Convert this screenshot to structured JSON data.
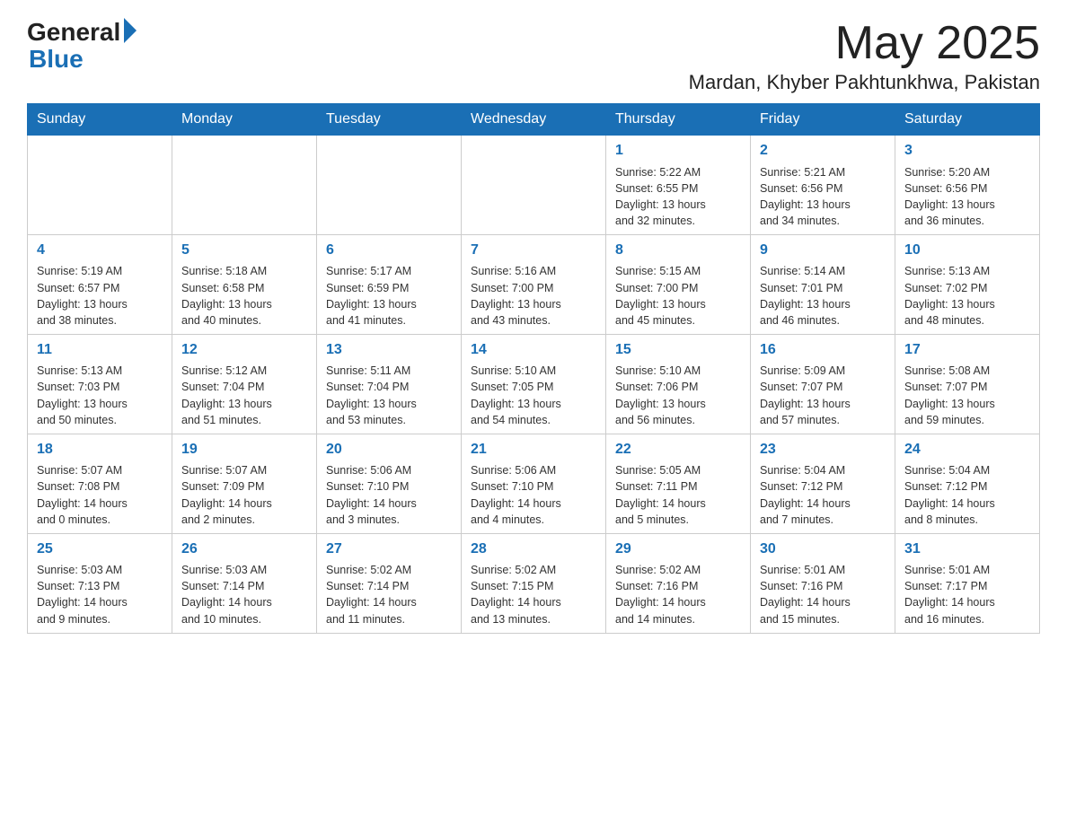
{
  "header": {
    "logo_general": "General",
    "logo_blue": "Blue",
    "month_title": "May 2025",
    "location": "Mardan, Khyber Pakhtunkhwa, Pakistan"
  },
  "weekdays": [
    "Sunday",
    "Monday",
    "Tuesday",
    "Wednesday",
    "Thursday",
    "Friday",
    "Saturday"
  ],
  "weeks": [
    [
      {
        "day": "",
        "info": ""
      },
      {
        "day": "",
        "info": ""
      },
      {
        "day": "",
        "info": ""
      },
      {
        "day": "",
        "info": ""
      },
      {
        "day": "1",
        "info": "Sunrise: 5:22 AM\nSunset: 6:55 PM\nDaylight: 13 hours\nand 32 minutes."
      },
      {
        "day": "2",
        "info": "Sunrise: 5:21 AM\nSunset: 6:56 PM\nDaylight: 13 hours\nand 34 minutes."
      },
      {
        "day": "3",
        "info": "Sunrise: 5:20 AM\nSunset: 6:56 PM\nDaylight: 13 hours\nand 36 minutes."
      }
    ],
    [
      {
        "day": "4",
        "info": "Sunrise: 5:19 AM\nSunset: 6:57 PM\nDaylight: 13 hours\nand 38 minutes."
      },
      {
        "day": "5",
        "info": "Sunrise: 5:18 AM\nSunset: 6:58 PM\nDaylight: 13 hours\nand 40 minutes."
      },
      {
        "day": "6",
        "info": "Sunrise: 5:17 AM\nSunset: 6:59 PM\nDaylight: 13 hours\nand 41 minutes."
      },
      {
        "day": "7",
        "info": "Sunrise: 5:16 AM\nSunset: 7:00 PM\nDaylight: 13 hours\nand 43 minutes."
      },
      {
        "day": "8",
        "info": "Sunrise: 5:15 AM\nSunset: 7:00 PM\nDaylight: 13 hours\nand 45 minutes."
      },
      {
        "day": "9",
        "info": "Sunrise: 5:14 AM\nSunset: 7:01 PM\nDaylight: 13 hours\nand 46 minutes."
      },
      {
        "day": "10",
        "info": "Sunrise: 5:13 AM\nSunset: 7:02 PM\nDaylight: 13 hours\nand 48 minutes."
      }
    ],
    [
      {
        "day": "11",
        "info": "Sunrise: 5:13 AM\nSunset: 7:03 PM\nDaylight: 13 hours\nand 50 minutes."
      },
      {
        "day": "12",
        "info": "Sunrise: 5:12 AM\nSunset: 7:04 PM\nDaylight: 13 hours\nand 51 minutes."
      },
      {
        "day": "13",
        "info": "Sunrise: 5:11 AM\nSunset: 7:04 PM\nDaylight: 13 hours\nand 53 minutes."
      },
      {
        "day": "14",
        "info": "Sunrise: 5:10 AM\nSunset: 7:05 PM\nDaylight: 13 hours\nand 54 minutes."
      },
      {
        "day": "15",
        "info": "Sunrise: 5:10 AM\nSunset: 7:06 PM\nDaylight: 13 hours\nand 56 minutes."
      },
      {
        "day": "16",
        "info": "Sunrise: 5:09 AM\nSunset: 7:07 PM\nDaylight: 13 hours\nand 57 minutes."
      },
      {
        "day": "17",
        "info": "Sunrise: 5:08 AM\nSunset: 7:07 PM\nDaylight: 13 hours\nand 59 minutes."
      }
    ],
    [
      {
        "day": "18",
        "info": "Sunrise: 5:07 AM\nSunset: 7:08 PM\nDaylight: 14 hours\nand 0 minutes."
      },
      {
        "day": "19",
        "info": "Sunrise: 5:07 AM\nSunset: 7:09 PM\nDaylight: 14 hours\nand 2 minutes."
      },
      {
        "day": "20",
        "info": "Sunrise: 5:06 AM\nSunset: 7:10 PM\nDaylight: 14 hours\nand 3 minutes."
      },
      {
        "day": "21",
        "info": "Sunrise: 5:06 AM\nSunset: 7:10 PM\nDaylight: 14 hours\nand 4 minutes."
      },
      {
        "day": "22",
        "info": "Sunrise: 5:05 AM\nSunset: 7:11 PM\nDaylight: 14 hours\nand 5 minutes."
      },
      {
        "day": "23",
        "info": "Sunrise: 5:04 AM\nSunset: 7:12 PM\nDaylight: 14 hours\nand 7 minutes."
      },
      {
        "day": "24",
        "info": "Sunrise: 5:04 AM\nSunset: 7:12 PM\nDaylight: 14 hours\nand 8 minutes."
      }
    ],
    [
      {
        "day": "25",
        "info": "Sunrise: 5:03 AM\nSunset: 7:13 PM\nDaylight: 14 hours\nand 9 minutes."
      },
      {
        "day": "26",
        "info": "Sunrise: 5:03 AM\nSunset: 7:14 PM\nDaylight: 14 hours\nand 10 minutes."
      },
      {
        "day": "27",
        "info": "Sunrise: 5:02 AM\nSunset: 7:14 PM\nDaylight: 14 hours\nand 11 minutes."
      },
      {
        "day": "28",
        "info": "Sunrise: 5:02 AM\nSunset: 7:15 PM\nDaylight: 14 hours\nand 13 minutes."
      },
      {
        "day": "29",
        "info": "Sunrise: 5:02 AM\nSunset: 7:16 PM\nDaylight: 14 hours\nand 14 minutes."
      },
      {
        "day": "30",
        "info": "Sunrise: 5:01 AM\nSunset: 7:16 PM\nDaylight: 14 hours\nand 15 minutes."
      },
      {
        "day": "31",
        "info": "Sunrise: 5:01 AM\nSunset: 7:17 PM\nDaylight: 14 hours\nand 16 minutes."
      }
    ]
  ]
}
